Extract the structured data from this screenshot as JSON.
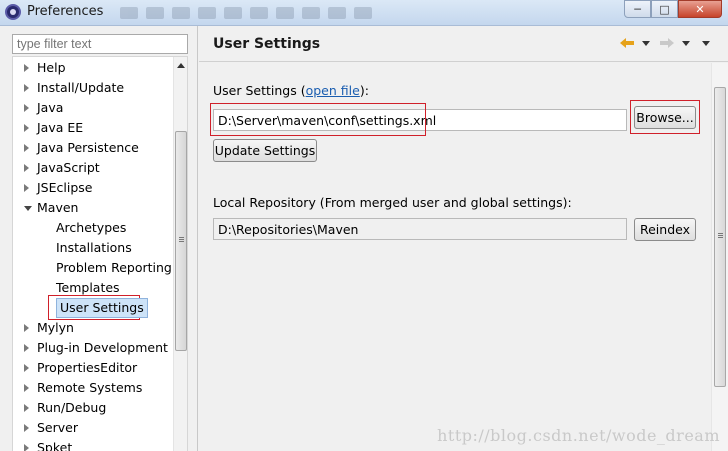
{
  "window": {
    "title": "Preferences",
    "icon": "eclipse-icon"
  },
  "left": {
    "filter_placeholder": "type filter text",
    "tree": [
      {
        "label": "Help",
        "expanded": false,
        "level": 0
      },
      {
        "label": "Install/Update",
        "expanded": false,
        "level": 0
      },
      {
        "label": "Java",
        "expanded": false,
        "level": 0
      },
      {
        "label": "Java EE",
        "expanded": false,
        "level": 0
      },
      {
        "label": "Java Persistence",
        "expanded": false,
        "level": 0
      },
      {
        "label": "JavaScript",
        "expanded": false,
        "level": 0
      },
      {
        "label": "JSEclipse",
        "expanded": false,
        "level": 0
      },
      {
        "label": "Maven",
        "expanded": true,
        "level": 0
      },
      {
        "label": "Archetypes",
        "level": 1
      },
      {
        "label": "Installations",
        "level": 1
      },
      {
        "label": "Problem Reporting",
        "level": 1
      },
      {
        "label": "Templates",
        "level": 1
      },
      {
        "label": "User Settings",
        "level": 1,
        "selected": true
      },
      {
        "label": "Mylyn",
        "expanded": false,
        "level": 0
      },
      {
        "label": "Plug-in Development",
        "expanded": false,
        "level": 0
      },
      {
        "label": "PropertiesEditor",
        "expanded": false,
        "level": 0
      },
      {
        "label": "Remote Systems",
        "expanded": false,
        "level": 0
      },
      {
        "label": "Run/Debug",
        "expanded": false,
        "level": 0
      },
      {
        "label": "Server",
        "expanded": false,
        "level": 0
      },
      {
        "label": "Spket",
        "expanded": false,
        "level": 0
      }
    ]
  },
  "right": {
    "page_title": "User Settings",
    "user_settings_label_pre": "User Settings (",
    "open_file_link": "open file",
    "user_settings_label_post": "):",
    "user_settings_value": "D:\\Server\\maven\\conf\\settings.xml",
    "browse_button": "Browse...",
    "update_settings_button": "Update Settings",
    "local_repo_label": "Local Repository (From merged user and global settings):",
    "local_repo_value": "D:\\Repositories\\Maven",
    "reindex_button": "Reindex"
  },
  "watermark": "http://blog.csdn.net/wode_dream",
  "colors": {
    "highlight": "#d0202a",
    "link": "#1a5db0",
    "selection": "#cde3f8"
  }
}
